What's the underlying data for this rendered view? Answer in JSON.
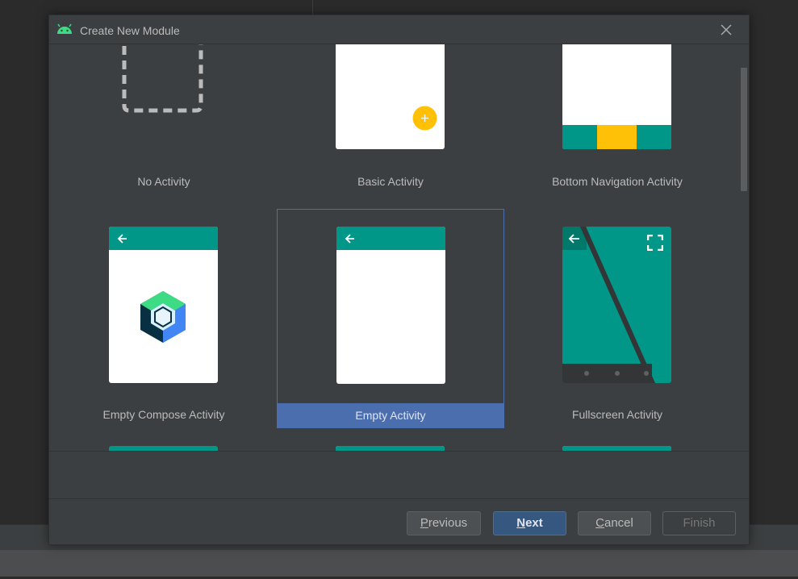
{
  "dialog": {
    "title": "Create New Module"
  },
  "templates": [
    {
      "label": "No Activity"
    },
    {
      "label": "Basic Activity"
    },
    {
      "label": "Bottom Navigation Activity"
    },
    {
      "label": "Empty Compose Activity"
    },
    {
      "label": "Empty Activity",
      "selected": true
    },
    {
      "label": "Fullscreen Activity"
    }
  ],
  "buttons": {
    "previous_first": "P",
    "previous_rest": "revious",
    "next_first": "N",
    "next_rest": "ext",
    "cancel_first": "C",
    "cancel_rest": "ancel",
    "finish": "Finish"
  },
  "colors": {
    "accent": "#4b6eaf",
    "teal": "#009688",
    "amber": "#ffc107",
    "primary_button": "#365880"
  },
  "icons": [
    "android-icon",
    "close-icon",
    "back-arrow-icon",
    "overflow-menu-icon",
    "fab-plus-icon",
    "fullscreen-icon",
    "compose-logo-icon"
  ]
}
